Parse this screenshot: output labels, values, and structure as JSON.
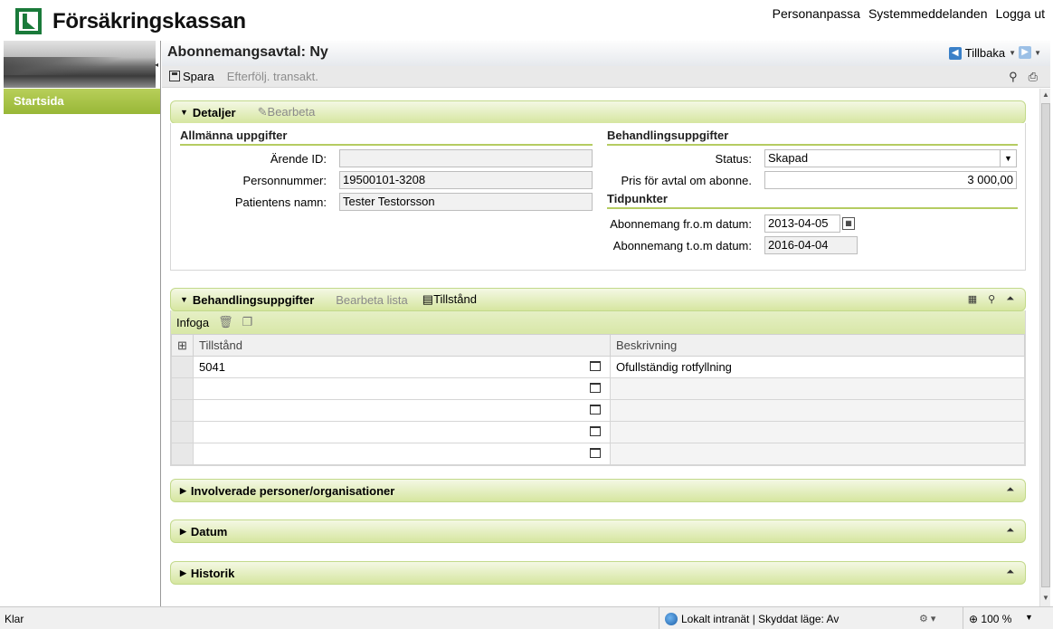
{
  "header": {
    "brand": "Försäkringskassan",
    "links": [
      "Personanpassa",
      "Systemmeddelanden",
      "Logga ut"
    ]
  },
  "sidebar": {
    "start_label": "Startsida"
  },
  "page": {
    "title": "Abonnemangsavtal: Ny",
    "back_label": "Tillbaka"
  },
  "toolbar": {
    "save_label": "Spara",
    "followup_label": "Efterfölj. transakt."
  },
  "details": {
    "title": "Detaljer",
    "edit_label": "Bearbeta",
    "general": {
      "title": "Allmänna uppgifter",
      "arende_label": "Ärende ID:",
      "arende_value": "",
      "pnr_label": "Personnummer:",
      "pnr_value": "19500101-3208",
      "name_label": "Patientens namn:",
      "name_value": "Tester Testorsson"
    },
    "treatment": {
      "title": "Behandlingsuppgifter",
      "status_label": "Status:",
      "status_value": "Skapad",
      "price_label": "Pris för avtal om abonne.",
      "price_value": "3 000,00"
    },
    "times": {
      "title": "Tidpunkter",
      "from_label": "Abonnemang fr.o.m datum:",
      "from_value": "2013-04-05",
      "to_label": "Abonnemang t.o.m datum:",
      "to_value": "2016-04-04"
    }
  },
  "grid_panel": {
    "title": "Behandlingsuppgifter",
    "edit_list_label": "Bearbeta lista",
    "condition_label": "Tillstånd",
    "insert_label": "Infoga",
    "columns": [
      "Tillstånd",
      "Beskrivning"
    ],
    "rows": [
      {
        "tillstand": "5041",
        "beskrivning": "Ofullständig rotfyllning"
      },
      {
        "tillstand": "",
        "beskrivning": ""
      },
      {
        "tillstand": "",
        "beskrivning": ""
      },
      {
        "tillstand": "",
        "beskrivning": ""
      },
      {
        "tillstand": "",
        "beskrivning": ""
      }
    ]
  },
  "collapsed_panels": [
    "Involverade personer/organisationer",
    "Datum",
    "Historik"
  ],
  "statusbar": {
    "left": "Klar",
    "zone": "Lokalt intranät | Skyddat läge: Av",
    "zoom": "100 %"
  },
  "colors": {
    "accent_green": "#98b737",
    "panel_header": "#d6e6a0",
    "brand_green": "#1a7a3a"
  }
}
